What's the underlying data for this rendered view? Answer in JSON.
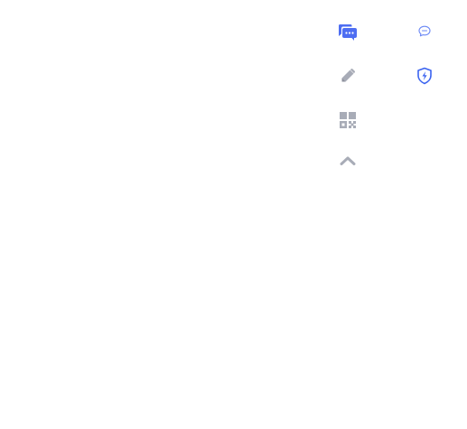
{
  "toolbar": {
    "items": [
      {
        "id": "chat",
        "icon": "chat-bubbles-icon",
        "color": "#4e6ef2"
      },
      {
        "id": "feedback",
        "icon": "pencil-icon",
        "color": "#a8acb7"
      },
      {
        "id": "qrcode",
        "icon": "qr-code-icon",
        "color": "#a8acb7"
      },
      {
        "id": "back-to-top",
        "icon": "chevron-up-icon",
        "color": "#a8acb7"
      }
    ]
  },
  "badges": {
    "items": [
      {
        "id": "message",
        "icon": "speech-bubble-icon",
        "color": "#6b88f5"
      },
      {
        "id": "security",
        "icon": "shield-lightning-icon",
        "color": "#3c64f0"
      }
    ]
  }
}
